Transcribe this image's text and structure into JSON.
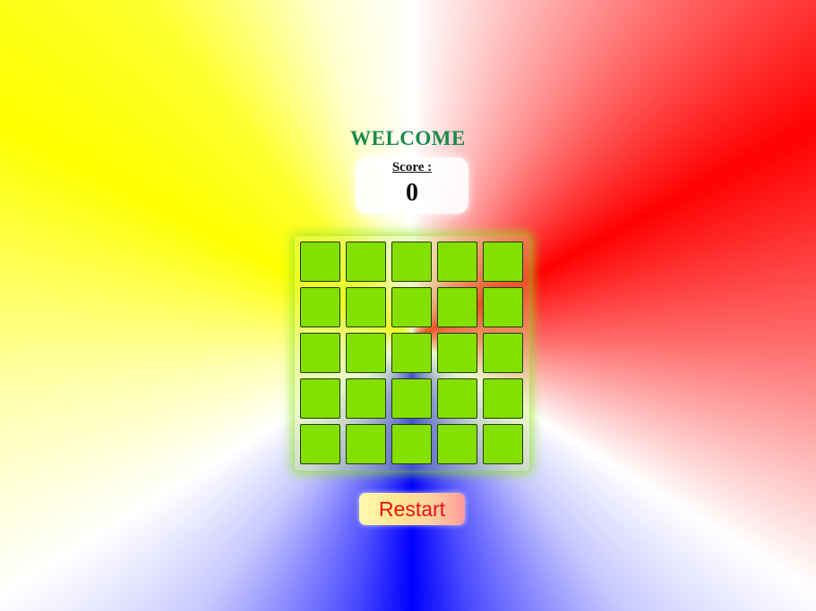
{
  "header": {
    "title": "WELCOME"
  },
  "score": {
    "label": "Score :",
    "value": "0"
  },
  "board": {
    "rows": 5,
    "cols": 5,
    "tile_color": "#84e000"
  },
  "controls": {
    "restart_label": "Restart"
  }
}
